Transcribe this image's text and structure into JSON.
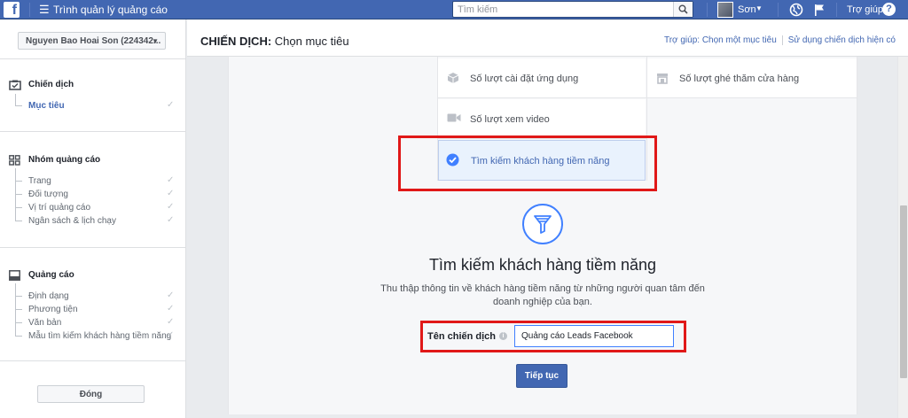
{
  "topbar": {
    "app_title": "Trình quản lý quảng cáo",
    "search_placeholder": "Tìm kiếm",
    "user_name": "Sơn",
    "help_label": "Trợ giúp",
    "help_glyph": "?"
  },
  "sidebar": {
    "account": "Nguyen Bao Hoai Son (224342...",
    "sections": [
      {
        "title": "Chiến dịch",
        "icon": "campaign-icon",
        "items": [
          {
            "label": "Mục tiêu",
            "active": true,
            "check": "✓"
          }
        ]
      },
      {
        "title": "Nhóm quảng cáo",
        "icon": "adset-icon",
        "items": [
          {
            "label": "Trang",
            "check": "✓"
          },
          {
            "label": "Đối tượng",
            "check": "✓"
          },
          {
            "label": "Vị trí quảng cáo",
            "check": "✓"
          },
          {
            "label": "Ngân sách & lịch chạy",
            "check": "✓"
          }
        ]
      },
      {
        "title": "Quảng cáo",
        "icon": "ad-icon",
        "items": [
          {
            "label": "Định dạng",
            "check": "✓"
          },
          {
            "label": "Phương tiện",
            "check": "✓"
          },
          {
            "label": "Văn bản",
            "check": "✓"
          },
          {
            "label": "Mẫu tìm kiếm khách hàng tiềm năng",
            "check": "✓"
          }
        ]
      }
    ],
    "close_label": "Đóng"
  },
  "header": {
    "title_bold": "CHIẾN DỊCH:",
    "title_rest": " Chọn mục tiêu",
    "help_link": "Trợ giúp: Chọn một mục tiêu",
    "existing_link": "Sử dụng chiến dịch hiện có"
  },
  "objectives": {
    "app_installs": "Số lượt cài đặt ứng dụng",
    "store_visits": "Số lượt ghé thăm cửa hàng",
    "video_views": "Số lượt xem video",
    "lead_generation": "Tìm kiếm khách hàng tiềm năng"
  },
  "detail": {
    "title": "Tìm kiếm khách hàng tiềm năng",
    "description": "Thu thập thông tin về khách hàng tiềm năng từ những người quan tâm đến doanh nghiệp của bạn.",
    "name_label": "Tên chiến dịch",
    "name_value": "Quảng cáo Leads Facebook",
    "continue_label": "Tiếp tục",
    "info_glyph": "i"
  },
  "colors": {
    "brand": "#4267b2",
    "highlight": "#e01818",
    "accent": "#4080ff"
  }
}
